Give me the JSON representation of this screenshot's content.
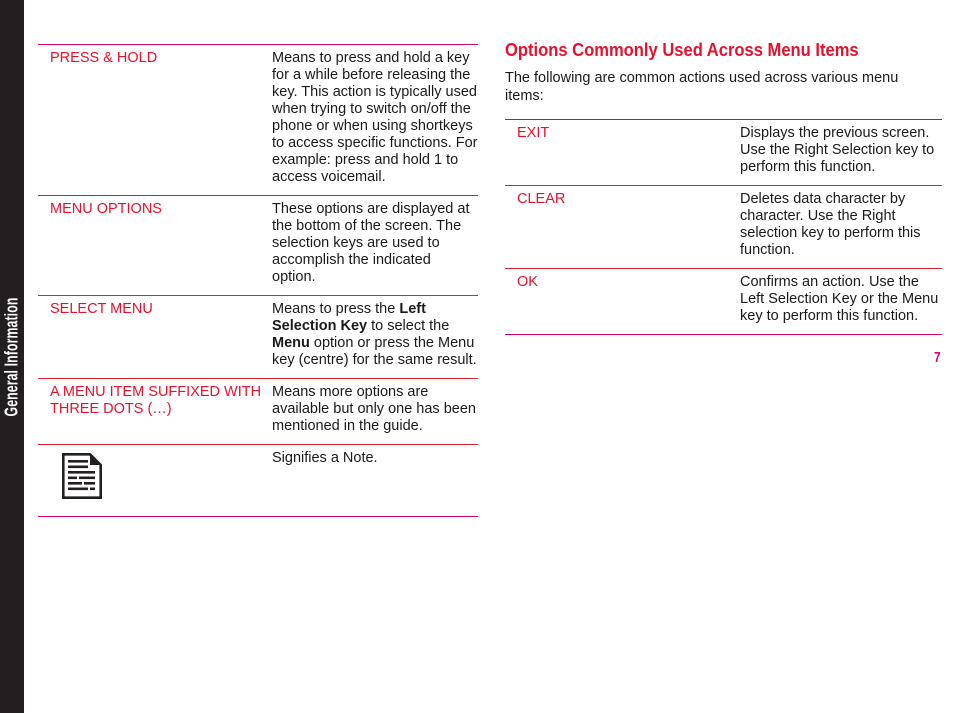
{
  "chapter_tab": {
    "label": "General Information"
  },
  "page_number": "7",
  "colors": {
    "accent_red": "#e8112d",
    "accent_magenta": "#d6006d",
    "tab_background": "#231f20",
    "body_text": "#1a1a1a"
  },
  "left_column": {
    "table": {
      "rows": [
        {
          "term": "PRESS & HOLD",
          "description": "Means to press and hold a key for a while before releasing the key. This action is typically used when trying to switch on/off the phone or when using shortkeys to access specific functions. For example: press and hold 1 to access voicemail."
        },
        {
          "term": "MENU OPTIONS",
          "description": "These options are displayed at the bottom of the screen. The selection keys are used to accomplish the indicated option."
        },
        {
          "term": "SELECT MENU",
          "description_parts": [
            {
              "text": "Means to press the ",
              "bold": false
            },
            {
              "text": "Left Selection Key",
              "bold": true
            },
            {
              "text": " to select the ",
              "bold": false
            },
            {
              "text": "Menu",
              "bold": true
            },
            {
              "text": " option or press the Menu key (centre) for the same result.",
              "bold": false
            }
          ]
        },
        {
          "term": "A MENU ITEM SUFFIXED WITH THREE DOTS (…)",
          "description": "Means more options are available but only one has been mentioned in the guide."
        },
        {
          "term_icon": "note-document-icon",
          "description": "Signifies a Note."
        }
      ]
    }
  },
  "right_column": {
    "heading": "Options Commonly Used Across Menu Items",
    "intro": "The following are common actions used across various menu items:",
    "table": {
      "rows": [
        {
          "term": "EXIT",
          "description": "Displays the previous screen. Use the Right Selection key to perform this function."
        },
        {
          "term": "CLEAR",
          "description": "Deletes data character by character. Use the Right selection key to perform this function."
        },
        {
          "term": "OK",
          "description": "Confirms an action. Use the Left Selection Key or the Menu key to perform this function."
        }
      ]
    }
  }
}
